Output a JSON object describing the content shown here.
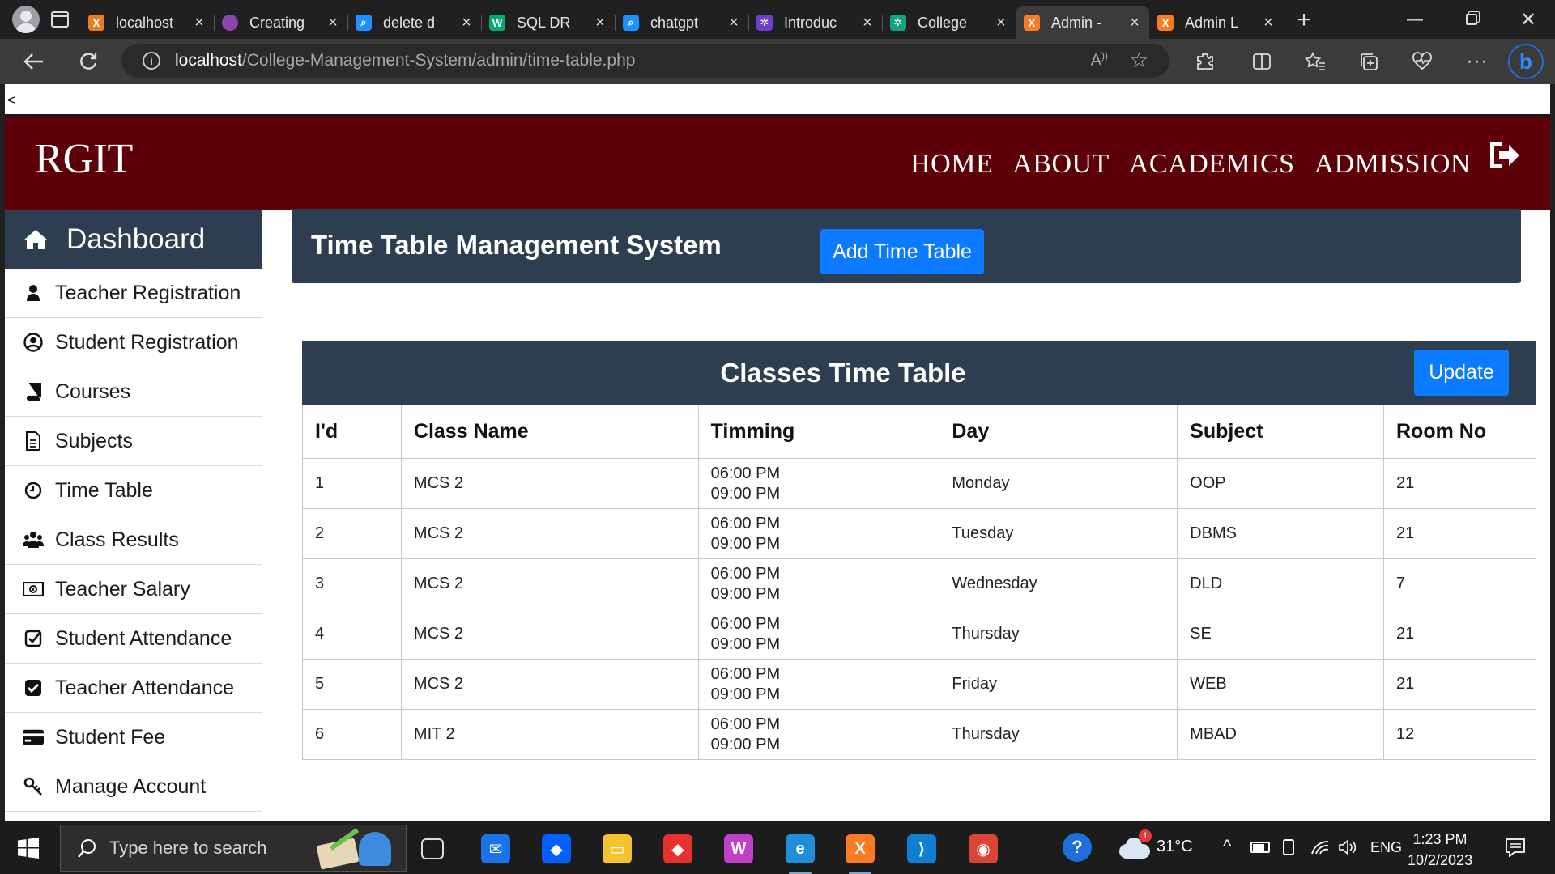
{
  "browser": {
    "tabs": [
      {
        "title": "localhost",
        "icon": "xampp",
        "color": "#e67e22"
      },
      {
        "title": "Creating",
        "icon": "avatar",
        "color": "#8e44ad"
      },
      {
        "title": "delete d",
        "icon": "search",
        "color": "#1e90ff"
      },
      {
        "title": "SQL DR",
        "icon": "w3schools",
        "color": "#04aa6d"
      },
      {
        "title": "chatgpt",
        "icon": "search",
        "color": "#1e90ff"
      },
      {
        "title": "Introduc",
        "icon": "openai",
        "color": "#6e40c9"
      },
      {
        "title": "College",
        "icon": "openai",
        "color": "#10a37f"
      },
      {
        "title": "Admin -",
        "icon": "xampp",
        "color": "#fb7a24",
        "active": true
      },
      {
        "title": "Admin L",
        "icon": "xampp",
        "color": "#fb7a24"
      }
    ],
    "url_host": "localhost",
    "url_path": "/College-Management-System/admin/time-table.php"
  },
  "page": {
    "back_glyph": "<",
    "brand": "RGIT",
    "nav": [
      "HOME",
      "ABOUT",
      "ACADEMICS",
      "ADMISSION"
    ]
  },
  "sidebar": {
    "dashboard": "Dashboard",
    "items": [
      {
        "label": "Teacher Registration",
        "icon": "user-icon"
      },
      {
        "label": "Student Registration",
        "icon": "user-circle-icon"
      },
      {
        "label": "Courses",
        "icon": "book-icon"
      },
      {
        "label": "Subjects",
        "icon": "file-text-icon"
      },
      {
        "label": "Time Table",
        "icon": "clock-icon"
      },
      {
        "label": "Class Results",
        "icon": "users-icon"
      },
      {
        "label": "Teacher Salary",
        "icon": "money-bill-icon"
      },
      {
        "label": "Student Attendance",
        "icon": "check-square-outline-icon"
      },
      {
        "label": "Teacher Attendance",
        "icon": "check-square-icon"
      },
      {
        "label": "Student Fee",
        "icon": "credit-card-icon"
      },
      {
        "label": "Manage Account",
        "icon": "key-icon"
      }
    ]
  },
  "timetable": {
    "header_title": "Time Table Management System",
    "add_button": "Add Time Table",
    "caption": "Classes Time Table",
    "update_button": "Update",
    "columns": [
      "I'd",
      "Class Name",
      "Timming",
      "Day",
      "Subject",
      "Room No"
    ],
    "rows": [
      {
        "id": "1",
        "class_name": "MCS 2",
        "time_start": "06:00 PM",
        "time_end": "09:00 PM",
        "day": "Monday",
        "subject": "OOP",
        "room": "21"
      },
      {
        "id": "2",
        "class_name": "MCS 2",
        "time_start": "06:00 PM",
        "time_end": "09:00 PM",
        "day": "Tuesday",
        "subject": "DBMS",
        "room": "21"
      },
      {
        "id": "3",
        "class_name": "MCS 2",
        "time_start": "06:00 PM",
        "time_end": "09:00 PM",
        "day": "Wednesday",
        "subject": "DLD",
        "room": "7"
      },
      {
        "id": "4",
        "class_name": "MCS 2",
        "time_start": "06:00 PM",
        "time_end": "09:00 PM",
        "day": "Thursday",
        "subject": "SE",
        "room": "21"
      },
      {
        "id": "5",
        "class_name": "MCS 2",
        "time_start": "06:00 PM",
        "time_end": "09:00 PM",
        "day": "Friday",
        "subject": "WEB",
        "room": "21"
      },
      {
        "id": "6",
        "class_name": "MIT 2",
        "time_start": "06:00 PM",
        "time_end": "09:00 PM",
        "day": "Thursday",
        "subject": "MBAD",
        "room": "12"
      }
    ]
  },
  "taskbar": {
    "search_placeholder": "Type here to search",
    "weather_temp": "31°C",
    "weather_badge": "1",
    "language": "ENG",
    "time": "1:23 PM",
    "date": "10/2/2023",
    "apps": [
      {
        "name": "task-view",
        "color": "#1c1c1c"
      },
      {
        "name": "mail",
        "color": "#1a73e8"
      },
      {
        "name": "dropbox",
        "color": "#0061fe"
      },
      {
        "name": "file-explorer",
        "color": "#f4c430"
      },
      {
        "name": "git",
        "color": "#e8312f"
      },
      {
        "name": "wps-office",
        "color": "#c33ec9"
      },
      {
        "name": "edge",
        "color": "#1e8fd6",
        "active": true
      },
      {
        "name": "xampp",
        "color": "#fb7a24",
        "active": true
      },
      {
        "name": "vscode",
        "color": "#0f7fd4"
      },
      {
        "name": "chrome",
        "color": "#db4437"
      }
    ]
  }
}
